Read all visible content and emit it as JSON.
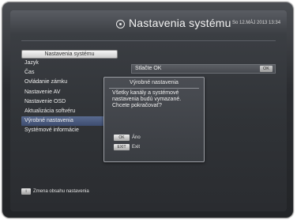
{
  "header": {
    "title": "Nastavenia systému",
    "icon": "settings-icon",
    "datetime": "So 12.MÁJ 2013 13:34"
  },
  "menu": {
    "header": "Nastavenia systému",
    "items": [
      {
        "label": "Jazyk",
        "selected": false
      },
      {
        "label": "Čas",
        "selected": false
      },
      {
        "label": "Ovládanie zámku",
        "selected": false
      },
      {
        "label": "Nastavenie AV",
        "selected": false
      },
      {
        "label": "Nastavenie OSD",
        "selected": false
      },
      {
        "label": "Aktualizácia softvéru",
        "selected": false
      },
      {
        "label": "Výrobné nastavenia",
        "selected": true
      },
      {
        "label": "Systémové informácie",
        "selected": false
      }
    ]
  },
  "option": {
    "label": "Stlačte OK",
    "button": "OK"
  },
  "dialog": {
    "title": "Výrobné nastavenia",
    "message": "Všetky kanály a systémové nastavenia budú vymazané. Chcete pokračovať?",
    "buttons": [
      {
        "key": "OK",
        "label": "Áno"
      },
      {
        "key": "EXIT",
        "label": "Exit"
      }
    ]
  },
  "footer": {
    "key": "i",
    "text": "Zmena obsahu nastavenia"
  },
  "colors": {
    "selection": "#4a5a80",
    "background": "#303337"
  }
}
